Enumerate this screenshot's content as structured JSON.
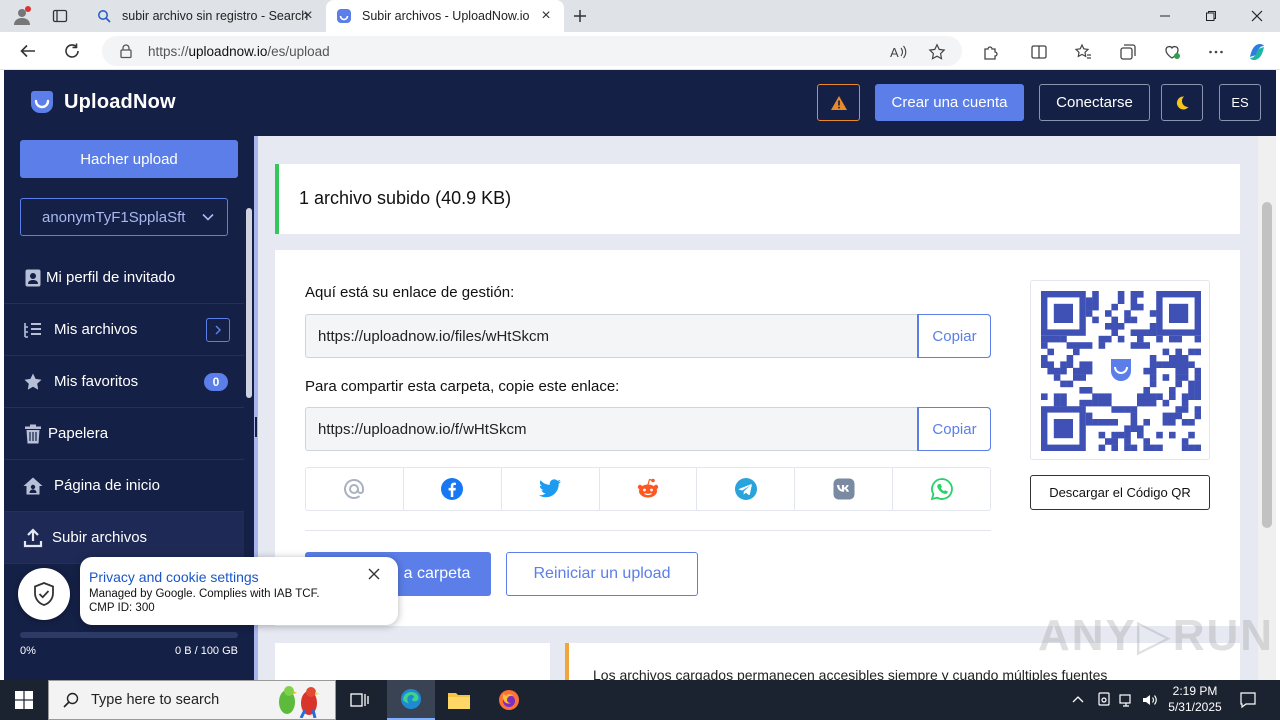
{
  "browser": {
    "tabs": [
      {
        "title": "subir archivo sin registro - Search",
        "favicon": "search-icon",
        "active": false
      },
      {
        "title": "Subir archivos - UploadNow.io",
        "favicon": "uploadnow-logo",
        "active": true
      }
    ],
    "url_prefix": "https://",
    "url_domain": "uploadnow.io",
    "url_path": "/es/upload"
  },
  "header": {
    "brand": "UploadNow",
    "create_account": "Crear una cuenta",
    "login": "Conectarse",
    "language": "ES"
  },
  "sidebar": {
    "upload_button": "Hacher upload",
    "account": "anonymTyF1SpplaSft",
    "items": [
      {
        "label": "Mi perfil de invitado",
        "icon": "user-badge-icon"
      },
      {
        "label": "Mis archivos",
        "icon": "list-icon"
      },
      {
        "label": "Mis favoritos",
        "icon": "star-icon",
        "badge": "0"
      },
      {
        "label": "Papelera",
        "icon": "trash-icon"
      },
      {
        "label": "Página de inicio",
        "icon": "home-icon"
      },
      {
        "label": "Subir archivos",
        "icon": "upload-icon"
      }
    ],
    "usage_percent": "0%",
    "usage_fraction": 0,
    "quota": "0 B / 100 GB"
  },
  "main": {
    "status": "1 archivo subido (40.9 KB)",
    "manage_label": "Aquí está su enlace de gestión:",
    "manage_link": "https://uploadnow.io/files/wHtSkcm",
    "share_label": "Para compartir esta carpeta, copie este enlace:",
    "share_link": "https://uploadnow.io/f/wHtSkcm",
    "copy": "Copiar",
    "share_icons": [
      "email-icon",
      "facebook-icon",
      "twitter-icon",
      "reddit-icon",
      "telegram-icon",
      "vk-icon",
      "whatsapp-icon"
    ],
    "folder_button_visible": "a carpeta",
    "restart_button": "Reiniciar un upload",
    "qr_download": "Descargar el Código QR",
    "bottom_text": "Los archivos cargados permanecen accesibles siempre y cuando múltiples fuentes"
  },
  "cookie": {
    "title": "Privacy and cookie settings",
    "line1": "Managed by Google. Complies with IAB TCF.",
    "line2": "CMP ID: 300"
  },
  "watermark": "ANY.RUN",
  "taskbar": {
    "search_placeholder": "Type here to search",
    "time": "2:19 PM",
    "date": "5/31/2025"
  },
  "colors": {
    "nav_bg": "#152046",
    "accent": "#5b7ee8",
    "success": "#34c759",
    "warning": "#e8892a"
  }
}
